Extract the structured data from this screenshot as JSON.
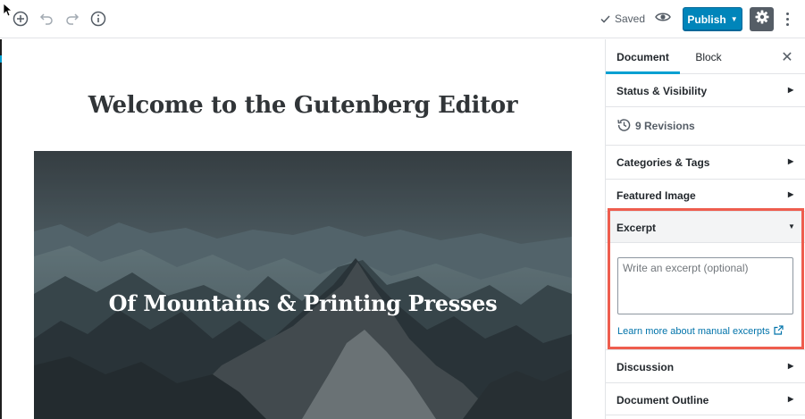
{
  "toolbar": {
    "saved_label": "Saved",
    "publish_label": "Publish"
  },
  "post": {
    "title": "Welcome to the Gutenberg Editor",
    "cover_text": "Of Mountains & Printing Presses"
  },
  "sidebar": {
    "tabs": [
      {
        "label": "Document"
      },
      {
        "label": "Block"
      }
    ],
    "close_glyph": "✕",
    "panels": {
      "status_visibility": "Status & Visibility",
      "revisions": "9 Revisions",
      "categories_tags": "Categories & Tags",
      "featured_image": "Featured Image",
      "excerpt": "Excerpt",
      "discussion": "Discussion",
      "document_outline": "Document Outline"
    },
    "excerpt": {
      "placeholder": "Write an excerpt (optional)",
      "value": "",
      "learn_more": "Learn more about manual excerpts"
    }
  },
  "colors": {
    "publish": "#0085ba",
    "link": "#0073aa",
    "highlight": "#ee5d4e",
    "active_tab": "#00a0d2"
  },
  "icons": [
    "cursor-icon",
    "add-block-icon",
    "undo-icon",
    "redo-icon",
    "info-icon",
    "check-icon",
    "eye-icon",
    "gear-icon",
    "more-vertical-icon",
    "close-icon",
    "history-icon",
    "chevron-right-icon",
    "chevron-down-icon",
    "external-link-icon"
  ]
}
